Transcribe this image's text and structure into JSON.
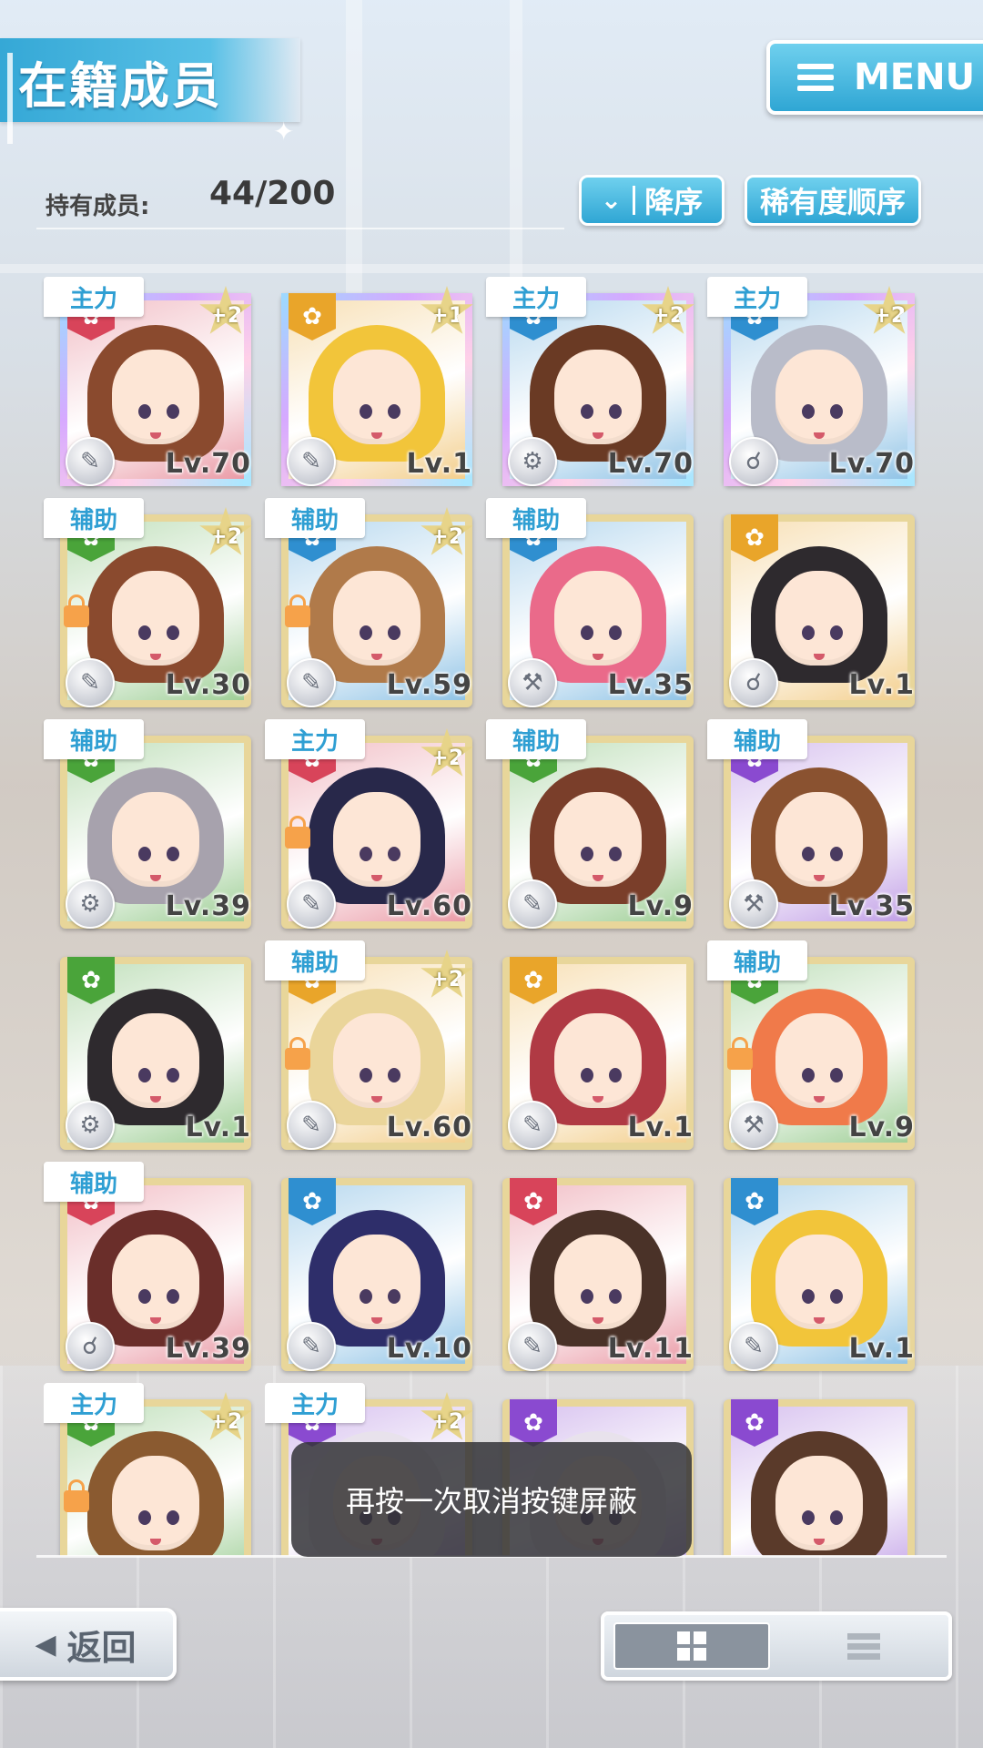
{
  "header": {
    "title": "在籍成员",
    "menu_label": "MENU"
  },
  "summary": {
    "count_label": "持有成员:",
    "count_value": "44/200"
  },
  "sort": {
    "order_label": "降序",
    "order_icon": "chevron-double-down-icon",
    "sort_by_label": "稀有度顺序"
  },
  "cards": [
    {
      "role": "主力",
      "stars": "+2",
      "level": "Lv.70",
      "attr": "red",
      "locked": false,
      "frame": "rainbow",
      "hair": "#8a4a2e"
    },
    {
      "role": "",
      "stars": "+1",
      "level": "Lv.1",
      "attr": "orange",
      "locked": false,
      "frame": "rainbow",
      "hair": "#f2c53a"
    },
    {
      "role": "主力",
      "stars": "+2",
      "level": "Lv.70",
      "attr": "blue",
      "locked": false,
      "frame": "rainbow",
      "hair": "#6a3a24"
    },
    {
      "role": "主力",
      "stars": "+2",
      "level": "Lv.70",
      "attr": "blue",
      "locked": false,
      "frame": "rainbow",
      "hair": "#b9bcc9"
    },
    {
      "role": "辅助",
      "stars": "+2",
      "level": "Lv.30",
      "attr": "green",
      "locked": true,
      "frame": "gold",
      "hair": "#8a4a2e"
    },
    {
      "role": "辅助",
      "stars": "+2",
      "level": "Lv.59",
      "attr": "blue",
      "locked": true,
      "frame": "gold",
      "hair": "#b07a4a"
    },
    {
      "role": "辅助",
      "stars": "",
      "level": "Lv.35",
      "attr": "blue",
      "locked": false,
      "frame": "gold",
      "hair": "#ea6a8a"
    },
    {
      "role": "",
      "stars": "",
      "level": "Lv.1",
      "attr": "orange",
      "locked": false,
      "frame": "gold",
      "hair": "#2e2a2e"
    },
    {
      "role": "辅助",
      "stars": "",
      "level": "Lv.39",
      "attr": "green",
      "locked": false,
      "frame": "gold",
      "hair": "#a7a2ad"
    },
    {
      "role": "主力",
      "stars": "+2",
      "level": "Lv.60",
      "attr": "red",
      "locked": true,
      "frame": "gold",
      "hair": "#28284a"
    },
    {
      "role": "辅助",
      "stars": "",
      "level": "Lv.9",
      "attr": "green",
      "locked": false,
      "frame": "gold",
      "hair": "#7a3e2a"
    },
    {
      "role": "辅助",
      "stars": "",
      "level": "Lv.35",
      "attr": "purple",
      "locked": false,
      "frame": "gold",
      "hair": "#8a5230"
    },
    {
      "role": "",
      "stars": "",
      "level": "Lv.1",
      "attr": "green",
      "locked": false,
      "frame": "gold",
      "hair": "#2e2a2e"
    },
    {
      "role": "辅助",
      "stars": "+2",
      "level": "Lv.60",
      "attr": "orange",
      "locked": true,
      "frame": "gold",
      "hair": "#ead59a"
    },
    {
      "role": "",
      "stars": "",
      "level": "Lv.1",
      "attr": "orange",
      "locked": false,
      "frame": "gold",
      "hair": "#b03a44"
    },
    {
      "role": "辅助",
      "stars": "",
      "level": "Lv.9",
      "attr": "green",
      "locked": true,
      "frame": "gold",
      "hair": "#f07a4a"
    },
    {
      "role": "辅助",
      "stars": "",
      "level": "Lv.39",
      "attr": "red",
      "locked": false,
      "frame": "gold",
      "hair": "#6a2e2a"
    },
    {
      "role": "",
      "stars": "",
      "level": "Lv.10",
      "attr": "blue",
      "locked": false,
      "frame": "gold",
      "hair": "#2e2e6a"
    },
    {
      "role": "",
      "stars": "",
      "level": "Lv.11",
      "attr": "red",
      "locked": false,
      "frame": "gold",
      "hair": "#4a3228"
    },
    {
      "role": "",
      "stars": "",
      "level": "Lv.1",
      "attr": "blue",
      "locked": false,
      "frame": "gold",
      "hair": "#f2c53a"
    },
    {
      "role": "主力",
      "stars": "+2",
      "level": "",
      "attr": "green",
      "locked": true,
      "frame": "gold",
      "hair": "#8a5a30"
    },
    {
      "role": "主力",
      "stars": "+2",
      "level": "",
      "attr": "purple",
      "locked": false,
      "frame": "gold",
      "hair": "#e8e2ec"
    },
    {
      "role": "",
      "stars": "",
      "level": "",
      "attr": "purple",
      "locked": false,
      "frame": "gold",
      "hair": "#e8e2ec"
    },
    {
      "role": "",
      "stars": "",
      "level": "",
      "attr": "purple",
      "locked": false,
      "frame": "gold",
      "hair": "#5a3a2a"
    }
  ],
  "attr_colors": {
    "red": "#d8445a",
    "orange": "#e9a52a",
    "blue": "#2f8fd0",
    "green": "#4aa43a",
    "purple": "#8a4ad0"
  },
  "type_icons": [
    "wrench-icon",
    "wrench-icon",
    "gear-icon",
    "microscope-icon",
    "wrench-icon",
    "wrench-icon",
    "hammer-icon",
    "microscope-icon",
    "gear-icon",
    "wrench-icon",
    "wrench-icon",
    "hammer-icon",
    "gear-icon",
    "wrench-icon",
    "wrench-icon",
    "hammer-icon",
    "microscope-icon",
    "wrench-icon",
    "wrench-icon",
    "wrench-icon",
    "",
    "",
    "",
    ""
  ],
  "toast": "再按一次取消按键屏蔽",
  "footer": {
    "back_label": "返回",
    "view_grid_icon": "grid-view-icon",
    "view_list_icon": "list-view-icon"
  }
}
